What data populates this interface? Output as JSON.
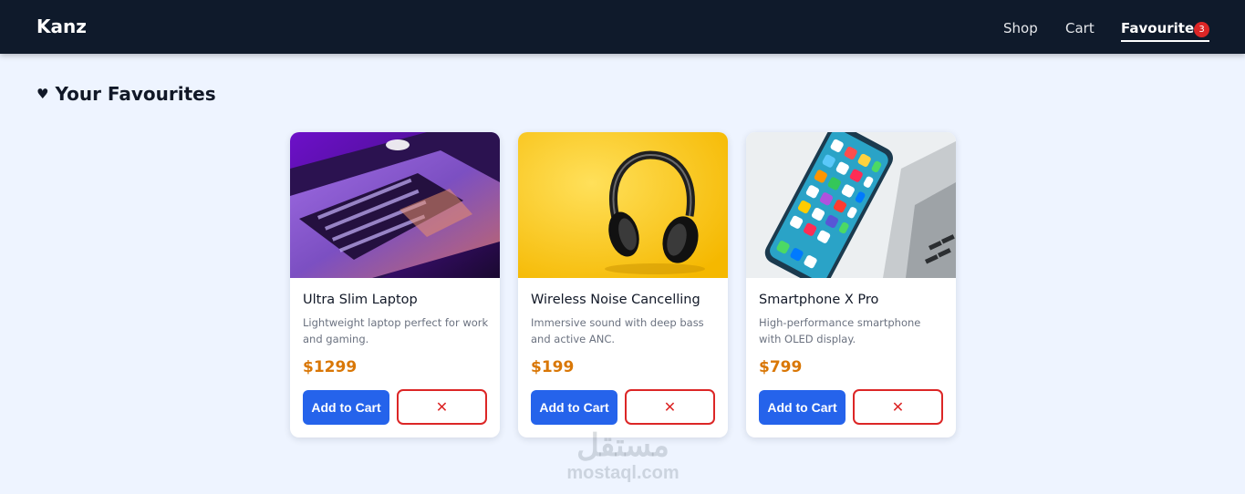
{
  "nav": {
    "brand": "Kanz",
    "links": [
      {
        "label": "Shop"
      },
      {
        "label": "Cart"
      },
      {
        "label": "Favourites",
        "badge": "3",
        "active": true
      }
    ]
  },
  "page": {
    "heart_icon": "♥",
    "title": "Your Favourites"
  },
  "products": [
    {
      "name": "Ultra Slim Laptop",
      "description": "Lightweight laptop perfect for work and gaming.",
      "price": "$1299",
      "image_icon": "laptop-image",
      "add_label": "Add to Cart",
      "remove_label": "✕"
    },
    {
      "name": "Wireless Noise Cancelling",
      "description": "Immersive sound with deep bass and active ANC.",
      "price": "$199",
      "image_icon": "headphones-image",
      "add_label": "Add to Cart",
      "remove_label": "✕"
    },
    {
      "name": "Smartphone X Pro",
      "description": "High-performance smartphone with OLED display.",
      "price": "$799",
      "image_icon": "smartphone-image",
      "add_label": "Add to Cart",
      "remove_label": "✕"
    }
  ],
  "watermark": {
    "arabic": "مستقل",
    "latin": "mostaql.com"
  },
  "colors": {
    "navbar": "#0f1a2b",
    "background": "#eef4ff",
    "primary_button": "#2563eb",
    "danger": "#dc2626",
    "price": "#d97706"
  }
}
